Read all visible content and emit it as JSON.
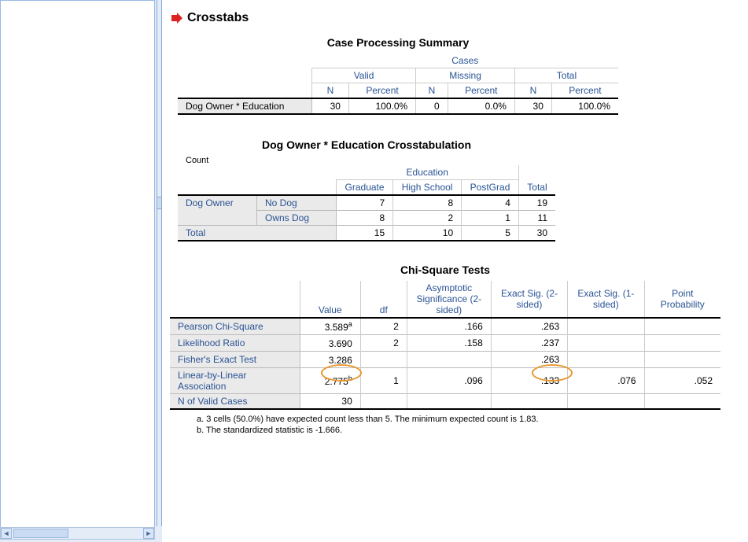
{
  "section_title": "Crosstabs",
  "case_summary": {
    "title": "Case Processing Summary",
    "super_header": "Cases",
    "col_groups": [
      "Valid",
      "Missing",
      "Total"
    ],
    "sub_cols": [
      "N",
      "Percent"
    ],
    "row_label": "Dog Owner * Education",
    "values": {
      "valid_n": "30",
      "valid_pct": "100.0%",
      "missing_n": "0",
      "missing_pct": "0.0%",
      "total_n": "30",
      "total_pct": "100.0%"
    }
  },
  "crosstab": {
    "title": "Dog Owner * Education Crosstabulation",
    "count_label": "Count",
    "col_super": "Education",
    "cols": [
      "Graduate",
      "High School",
      "PostGrad"
    ],
    "total_col": "Total",
    "row_super": "Dog Owner",
    "rows": [
      {
        "label": "No Dog",
        "vals": [
          "7",
          "8",
          "4"
        ],
        "total": "19"
      },
      {
        "label": "Owns Dog",
        "vals": [
          "8",
          "2",
          "1"
        ],
        "total": "11"
      }
    ],
    "total_row_label": "Total",
    "total_row_vals": [
      "15",
      "10",
      "5"
    ],
    "total_row_total": "30"
  },
  "chi_square": {
    "title": "Chi-Square Tests",
    "cols": [
      "Value",
      "df",
      "Asymptotic Significance (2-sided)",
      "Exact Sig. (2-sided)",
      "Exact Sig. (1-sided)",
      "Point Probability"
    ],
    "rows": [
      {
        "label": "Pearson Chi-Square",
        "value": "3.589",
        "sup": "a",
        "df": "2",
        "asym": ".166",
        "ex2": ".263",
        "ex1": "",
        "pp": ""
      },
      {
        "label": "Likelihood Ratio",
        "value": "3.690",
        "sup": "",
        "df": "2",
        "asym": ".158",
        "ex2": ".237",
        "ex1": "",
        "pp": ""
      },
      {
        "label": "Fisher's Exact Test",
        "value": "3.286",
        "sup": "",
        "df": "",
        "asym": "",
        "ex2": ".263",
        "ex1": "",
        "pp": ""
      },
      {
        "label": "Linear-by-Linear Association",
        "value": "2.775",
        "sup": "b",
        "df": "1",
        "asym": ".096",
        "ex2": ".133",
        "ex1": ".076",
        "pp": ".052"
      },
      {
        "label": "N of Valid Cases",
        "value": "30",
        "sup": "",
        "df": "",
        "asym": "",
        "ex2": "",
        "ex1": "",
        "pp": ""
      }
    ],
    "footnote_a": "a. 3 cells (50.0%) have expected count less than 5. The minimum expected count is 1.83.",
    "footnote_b": "b. The standardized statistic is -1.666."
  },
  "chart_data": null
}
